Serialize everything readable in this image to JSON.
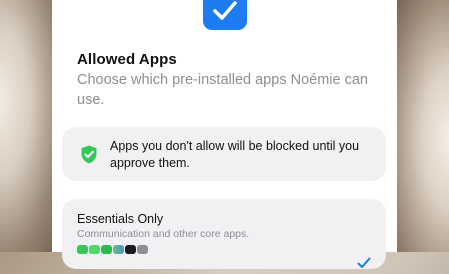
{
  "header": {
    "title": "Allowed Apps",
    "subtitle": "Choose which pre-installed apps Noémie can use."
  },
  "notice": {
    "text": "Apps you don't allow will be blocked until you approve them.",
    "icon": "shield-check-icon",
    "color": "#34c759"
  },
  "option": {
    "title": "Essentials Only",
    "subtitle": "Communication and other core apps.",
    "selected": true,
    "check_color": "#1c7cf0",
    "app_icons": [
      "phone-app-icon",
      "messages-app-icon",
      "facetime-app-icon",
      "maps-app-icon",
      "clock-app-icon",
      "settings-app-icon"
    ]
  },
  "colors": {
    "accent": "#1c7cf0",
    "card_bg": "#f1f1f4",
    "secondary_text": "#8e8e93"
  }
}
